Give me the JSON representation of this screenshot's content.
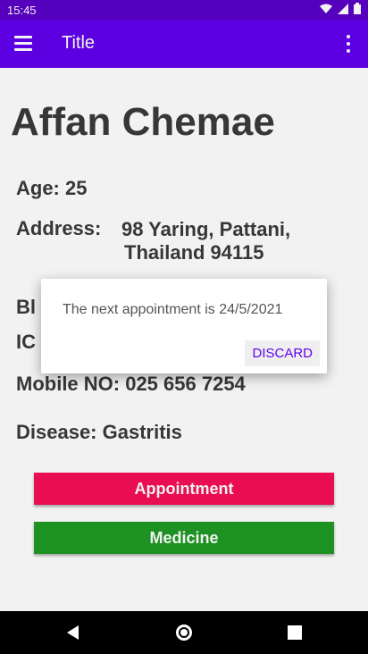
{
  "status": {
    "time": "15:45",
    "icons": [
      "wifi-icon",
      "signal-icon",
      "battery-icon"
    ]
  },
  "appbar": {
    "title": "Title",
    "menu_icon": "menu-icon",
    "more_icon": "more-vert-icon"
  },
  "patient": {
    "name": "Affan Chemae",
    "age_label": "Age: 25",
    "address_label": "Address:",
    "address_line1": "98 Yaring, Pattani,",
    "address_line2": "Thailand 94115",
    "blood_label_partial": "Bl",
    "ic_label_partial": "IC",
    "mobile_label": "Mobile NO: 025 656 7254",
    "disease_label": "Disease: Gastritis"
  },
  "buttons": {
    "appointment": "Appointment",
    "medicine": "Medicine"
  },
  "dialog": {
    "message": "The next appointment is 24/5/2021",
    "discard": "DISCARD"
  },
  "colors": {
    "statusbar": "#5a00c8",
    "appbar": "#6200ee",
    "appointment": "#f50f56",
    "medicine": "#1f9a24"
  }
}
